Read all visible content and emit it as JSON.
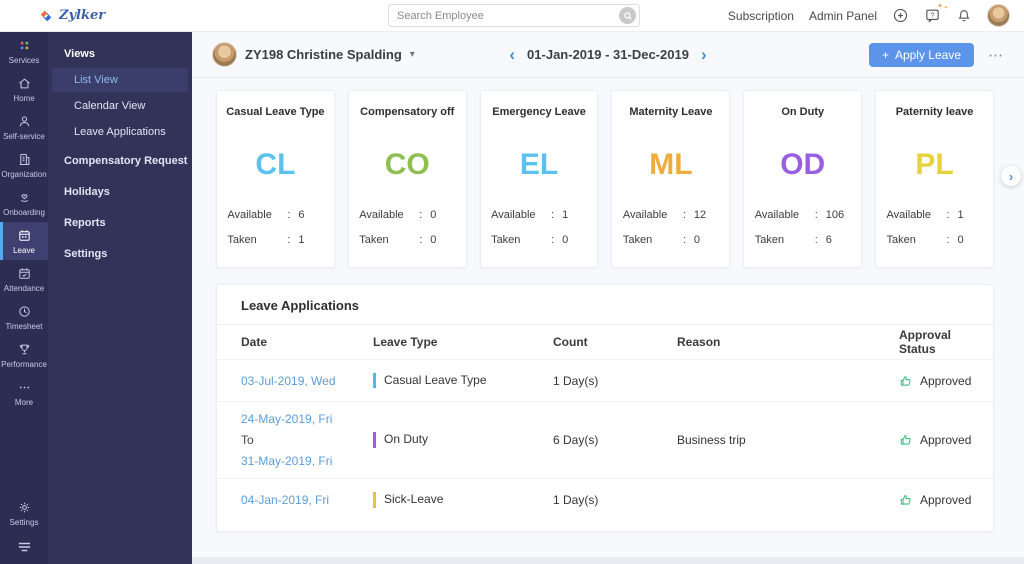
{
  "topbar": {
    "brand": "Zylker",
    "search_placeholder": "Search Employee",
    "links": [
      {
        "label": "Subscription"
      },
      {
        "label": "Admin Panel"
      }
    ]
  },
  "icons": {
    "plus": "+",
    "question": "?",
    "sparkle": "✦",
    "caret_down": "▾",
    "chevron_left": "‹",
    "chevron_right": "›",
    "ellipsis": "⋯"
  },
  "sidebar": {
    "items": [
      {
        "label": "Services"
      },
      {
        "label": "Home"
      },
      {
        "label": "Self-service"
      },
      {
        "label": "Organization"
      },
      {
        "label": "Onboarding"
      },
      {
        "label": "Leave",
        "active": true
      },
      {
        "label": "Attendance"
      },
      {
        "label": "Timesheet"
      },
      {
        "label": "Performance"
      },
      {
        "label": "More"
      },
      {
        "label": "Settings"
      }
    ]
  },
  "panel": {
    "views_label": "Views",
    "view_items": [
      {
        "label": "List View",
        "active": true
      },
      {
        "label": "Calendar View"
      },
      {
        "label": "Leave Applications"
      }
    ],
    "items": [
      {
        "label": "Compensatory Request"
      },
      {
        "label": "Holidays"
      },
      {
        "label": "Reports"
      },
      {
        "label": "Settings"
      }
    ]
  },
  "header": {
    "employee": "ZY198 Christine Spalding",
    "date_range": "01-Jan-2019 - 31-Dec-2019",
    "apply_label": "Apply Leave"
  },
  "labels": {
    "available": "Available",
    "taken": "Taken",
    "colon": ":"
  },
  "leave_cards": [
    {
      "title": "Casual Leave Type",
      "code": "CL",
      "color": "#5bc2f0",
      "available": "6",
      "taken": "1"
    },
    {
      "title": "Compensatory off",
      "code": "CO",
      "color": "#8fbf52",
      "available": "0",
      "taken": "0"
    },
    {
      "title": "Emergency Leave",
      "code": "EL",
      "color": "#5bc2f0",
      "available": "1",
      "taken": "0"
    },
    {
      "title": "Maternity Leave",
      "code": "ML",
      "color": "#efab3f",
      "available": "12",
      "taken": "0"
    },
    {
      "title": "On Duty",
      "code": "OD",
      "color": "#9a5fe0",
      "available": "106",
      "taken": "6"
    },
    {
      "title": "Paternity leave",
      "code": "PL",
      "color": "#e8d13f",
      "available": "1",
      "taken": "0"
    }
  ],
  "table": {
    "title": "Leave Applications",
    "columns": [
      {
        "label": "Date"
      },
      {
        "label": "Leave Type"
      },
      {
        "label": "Count"
      },
      {
        "label": "Reason"
      },
      {
        "label": "Approval Status"
      }
    ],
    "rows": [
      {
        "date": "03-Jul-2019, Wed",
        "leave_type": "Casual Leave Type",
        "bar_color": "#56b6ea",
        "count": "1 Day(s)",
        "reason": "",
        "status": "Approved"
      },
      {
        "date": "24-May-2019, Fri",
        "to_label": "To",
        "date_to": "31-May-2019, Fri",
        "leave_type": "On Duty",
        "bar_color": "#9a5fe0",
        "count": "6 Day(s)",
        "reason": "Business trip",
        "status": "Approved"
      },
      {
        "date": "04-Jan-2019, Fri",
        "leave_type": "Sick-Leave",
        "bar_color": "#e8c23a",
        "count": "1 Day(s)",
        "reason": "",
        "status": "Approved"
      }
    ],
    "status_color": "#3fbf7f"
  }
}
